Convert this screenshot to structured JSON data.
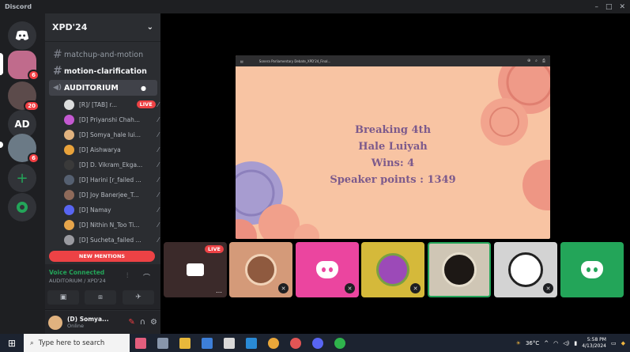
{
  "window": {
    "title": "Discord",
    "controls": [
      "–",
      "□",
      "✕"
    ]
  },
  "servers": [
    {
      "label": "",
      "icon": "discord-home-icon"
    },
    {
      "label": "",
      "badge": "6",
      "icon": "server-xpd-icon"
    },
    {
      "label": "",
      "badge": "20",
      "icon": "server-tried-icon"
    },
    {
      "label": "AD"
    },
    {
      "label": "",
      "badge": "6",
      "icon": "server-image-icon"
    },
    {
      "label": "+",
      "icon": "add-server-icon"
    },
    {
      "label": "",
      "icon": "discover-icon"
    }
  ],
  "guild": {
    "name": "XPD'24"
  },
  "channels": [
    {
      "label": "matchup-and-motion",
      "icon": "#"
    },
    {
      "label": "motion-clarification",
      "icon": "#"
    }
  ],
  "voice_channel": {
    "label": "AUDITORIUM"
  },
  "voice_users": [
    {
      "name": "[R]/ [TAB] r...",
      "live": "LIVE",
      "color": "#dcdddd"
    },
    {
      "name": "[D] Priyanshi Chah...",
      "color": "#c459d1"
    },
    {
      "name": "[D] Somya_hale lui...",
      "color": "#e0b27f"
    },
    {
      "name": "[D] Aishwarya",
      "color": "#e8a23b"
    },
    {
      "name": "[D] D. Vikram_Ekga...",
      "color": "#3a3a3a"
    },
    {
      "name": "[D] Harini [r_failed ...",
      "color": "#556071"
    },
    {
      "name": "[D] Joy Banerjee_T...",
      "color": "#8e6a5a"
    },
    {
      "name": "[D] Namay",
      "color": "#5865f2"
    },
    {
      "name": "[D] Nithin N_Too Ti...",
      "color": "#e6a54b"
    },
    {
      "name": "[D] Sucheta_failed ...",
      "color": "#9a9aa0"
    }
  ],
  "new_mentions": "NEW MENTIONS",
  "voice_panel": {
    "status": "Voice Connected",
    "location": "AUDITORIUM / XPD'24"
  },
  "user": {
    "name": "(D) Somya...",
    "status": "Online"
  },
  "presentation": {
    "toolbar_title": "Sonera Parliamentary Debate_XPD'24_Final...",
    "lines": [
      "Breaking 4th",
      "Hale Luiyah",
      "Wins: 4",
      "Speaker points : 1349"
    ],
    "bg_color": "#f8c4a3",
    "text_color": "#7c5a8c"
  },
  "tiles": [
    {
      "kind": "stream",
      "badge": "LIVE",
      "color": "#3b2a2a"
    },
    {
      "kind": "photo",
      "color": "#d49a79"
    },
    {
      "kind": "discord",
      "color": "#eb459f"
    },
    {
      "kind": "photo",
      "color": "#d5b93a"
    },
    {
      "kind": "photo",
      "color": "#cfc6b5",
      "speaking": true
    },
    {
      "kind": "photo",
      "color": "#d3d3d3"
    },
    {
      "kind": "discord",
      "color": "#23a559"
    }
  ],
  "taskbar": {
    "search_placeholder": "Type here to search",
    "weather": "36°C",
    "time": "5:58 PM",
    "date": "4/13/2024"
  }
}
